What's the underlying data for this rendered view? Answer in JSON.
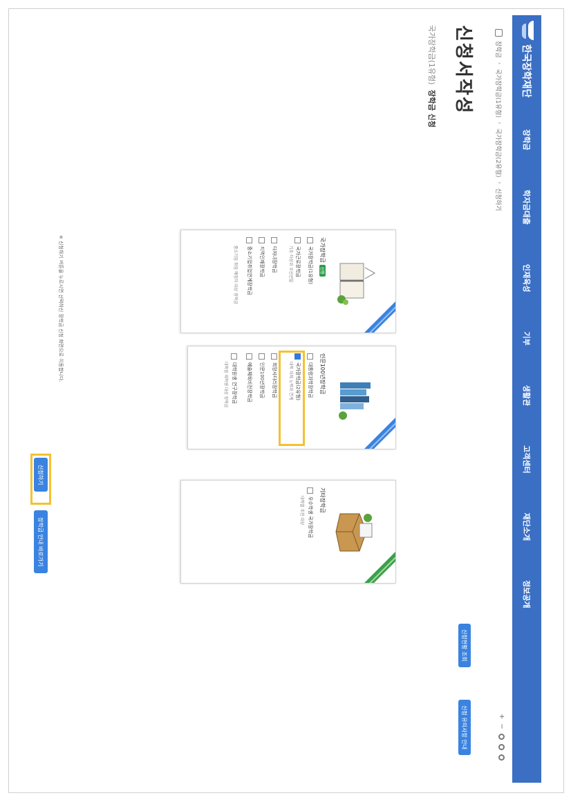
{
  "nav": {
    "logo_text": "한국장학재단",
    "menu": [
      "장학금",
      "학자금대출",
      "인재육성",
      "기부",
      "생활관",
      "고객센터",
      "재단소개",
      "정보공개"
    ]
  },
  "breadcrumb": [
    "장학금",
    "국가장학금(1유형)",
    "국가장학금(2유형)",
    "신청하기"
  ],
  "utils": {
    "plus": "+",
    "minus": "−"
  },
  "page_title": "신청서작성",
  "subtitle": {
    "prefix": "국가장학금(1유형)",
    "strong": "장학금 신청"
  },
  "header_buttons": [
    "신청현황 조회",
    "신청 유의사항 안내"
  ],
  "cards": [
    {
      "title": "국가장학금",
      "tag": "신청",
      "items": [
        {
          "label": "국가장학금(1유형)",
          "checked": false,
          "desc": ""
        },
        {
          "label": "국가근로장학금",
          "checked": false,
          "desc": "기초·차상위 우선선발"
        },
        {
          "label": "다자녀장학금",
          "checked": false,
          "desc": ""
        },
        {
          "label": "지역인재장학금",
          "checked": false,
          "desc": ""
        },
        {
          "label": "중소기업취업연계장학금",
          "checked": false,
          "desc": "중소기업 취업 예정자 대상 장학금"
        }
      ]
    },
    {
      "title": "인문100년장학금",
      "tag": "",
      "items": [
        {
          "label": "대통령과학장학금",
          "checked": false,
          "desc": ""
        },
        {
          "label": "국가장학금(2유형)",
          "checked": true,
          "desc": "대학 자체 노력과 연계"
        },
        {
          "label": "희망사다리장학금",
          "checked": false,
          "desc": ""
        },
        {
          "label": "인문100년장학금",
          "checked": false,
          "desc": ""
        },
        {
          "label": "예술체육비전장학금",
          "checked": false,
          "desc": ""
        },
        {
          "label": "대학원생 연구장학금",
          "checked": false,
          "desc": "대학원 재학생 대상 장학금"
        }
      ]
    },
    {
      "title": "기타장학금",
      "tag": "",
      "items": [
        {
          "label": "우수학생 국가장학금",
          "checked": false,
          "desc": "대학별 추천 대상"
        }
      ]
    }
  ],
  "notice": "※ 신청하기 버튼을 누르시면 선택하신 장학금 신청 화면으로 이동합니다.",
  "bottom_buttons": [
    "신청하기",
    "장학금 안내 바로가기"
  ],
  "colors": {
    "brand": "#3a6fc4",
    "highlight": "#f2c232",
    "check": "#2f7bdc"
  }
}
